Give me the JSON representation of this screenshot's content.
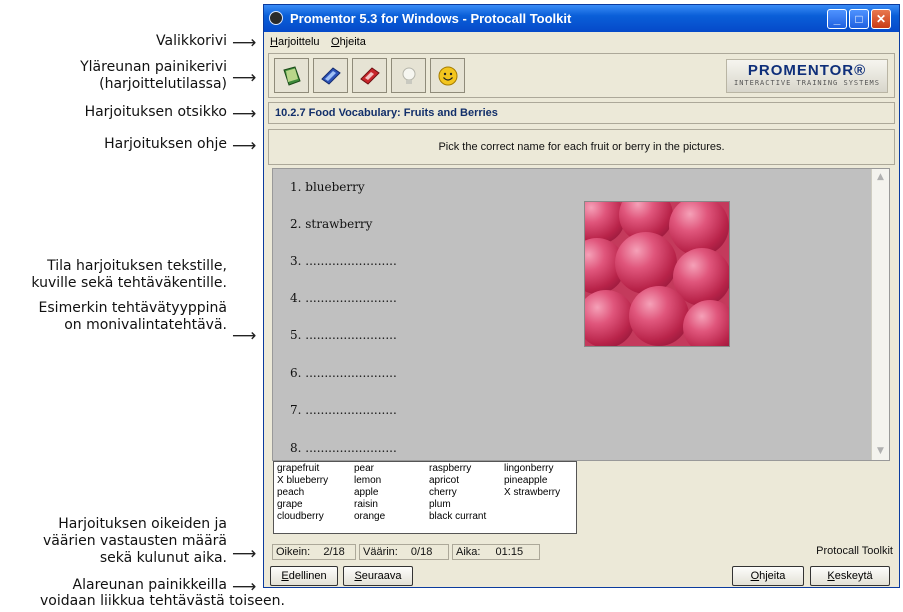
{
  "annotations": {
    "menubar": "Valikkorivi",
    "toolbar_line1": "Yläreunan painikerivi",
    "toolbar_line2": "(harjoittelutilassa)",
    "title": "Harjoituksen otsikko",
    "instruction": "Harjoituksen ohje",
    "area_line1": "Tila harjoituksen tekstille,",
    "area_line2": "kuville sekä tehtäväkentille.",
    "area_line3": "Esimerkin tehtävätyyppinä",
    "area_line4": "on monivalintatehtävä.",
    "status_line1": "Harjoituksen oikeiden ja",
    "status_line2": "väärien vastausten määrä",
    "status_line3": "sekä kulunut aika.",
    "nav_line1": "Alareunan painikkeilla",
    "nav_line2": "voidaan liikkua tehtävästä toiseen.",
    "arrow": "⟶"
  },
  "window": {
    "title": "Promentor 5.3 for Windows - Protocall Toolkit",
    "controls": [
      "_",
      "□",
      "✕"
    ]
  },
  "menu": [
    {
      "first": "H",
      "rest": "arjoittelu"
    },
    {
      "first": "O",
      "rest": "hjeita"
    }
  ],
  "toolbar": {
    "icons": [
      "book-icon",
      "dictionary-icon",
      "grammar-book-icon",
      "hint-bulb-icon",
      "smiley-icon"
    ]
  },
  "logo": {
    "brand": "PROMENTOR®",
    "tagline": "INTERACTIVE TRAINING SYSTEMS"
  },
  "exercise": {
    "title": "10.2.7 Food Vocabulary: Fruits and Berries",
    "instruction": "Pick the correct name for each fruit or berry in the pictures."
  },
  "answers": [
    "1. blueberry",
    "2. strawberry",
    "3. ........................",
    "4. ........................",
    "5. ........................",
    "6. ........................",
    "7. ........................",
    "8. ........................"
  ],
  "choices": {
    "col1": [
      "grapefruit",
      "X  blueberry",
      "peach",
      "grape",
      "cloudberry"
    ],
    "col2": [
      "pear",
      "lemon",
      "apple",
      "raisin",
      "orange"
    ],
    "col3": [
      "raspberry",
      "apricot",
      "cherry",
      "plum",
      "black currant"
    ],
    "col4": [
      "lingonberry",
      "pineapple",
      "X  strawberry"
    ]
  },
  "status": {
    "correct_label": "Oikein:",
    "correct_value": "2/18",
    "wrong_label": "Väärin:",
    "wrong_value": "0/18",
    "time_label": "Aika:",
    "time_value": "01:15",
    "product": "Protocall Toolkit"
  },
  "buttons": {
    "prev": {
      "first": "E",
      "rest": "dellinen"
    },
    "next": {
      "first": "S",
      "rest": "euraava"
    },
    "help": {
      "first": "O",
      "rest": "hjeita"
    },
    "abort": {
      "first": "K",
      "rest": "eskeytä"
    }
  },
  "colors": {
    "titlebar": "#0a5fd8",
    "window_bg": "#ece9d8",
    "work_area": "#c0c0c0",
    "title_text": "#122f6a"
  }
}
